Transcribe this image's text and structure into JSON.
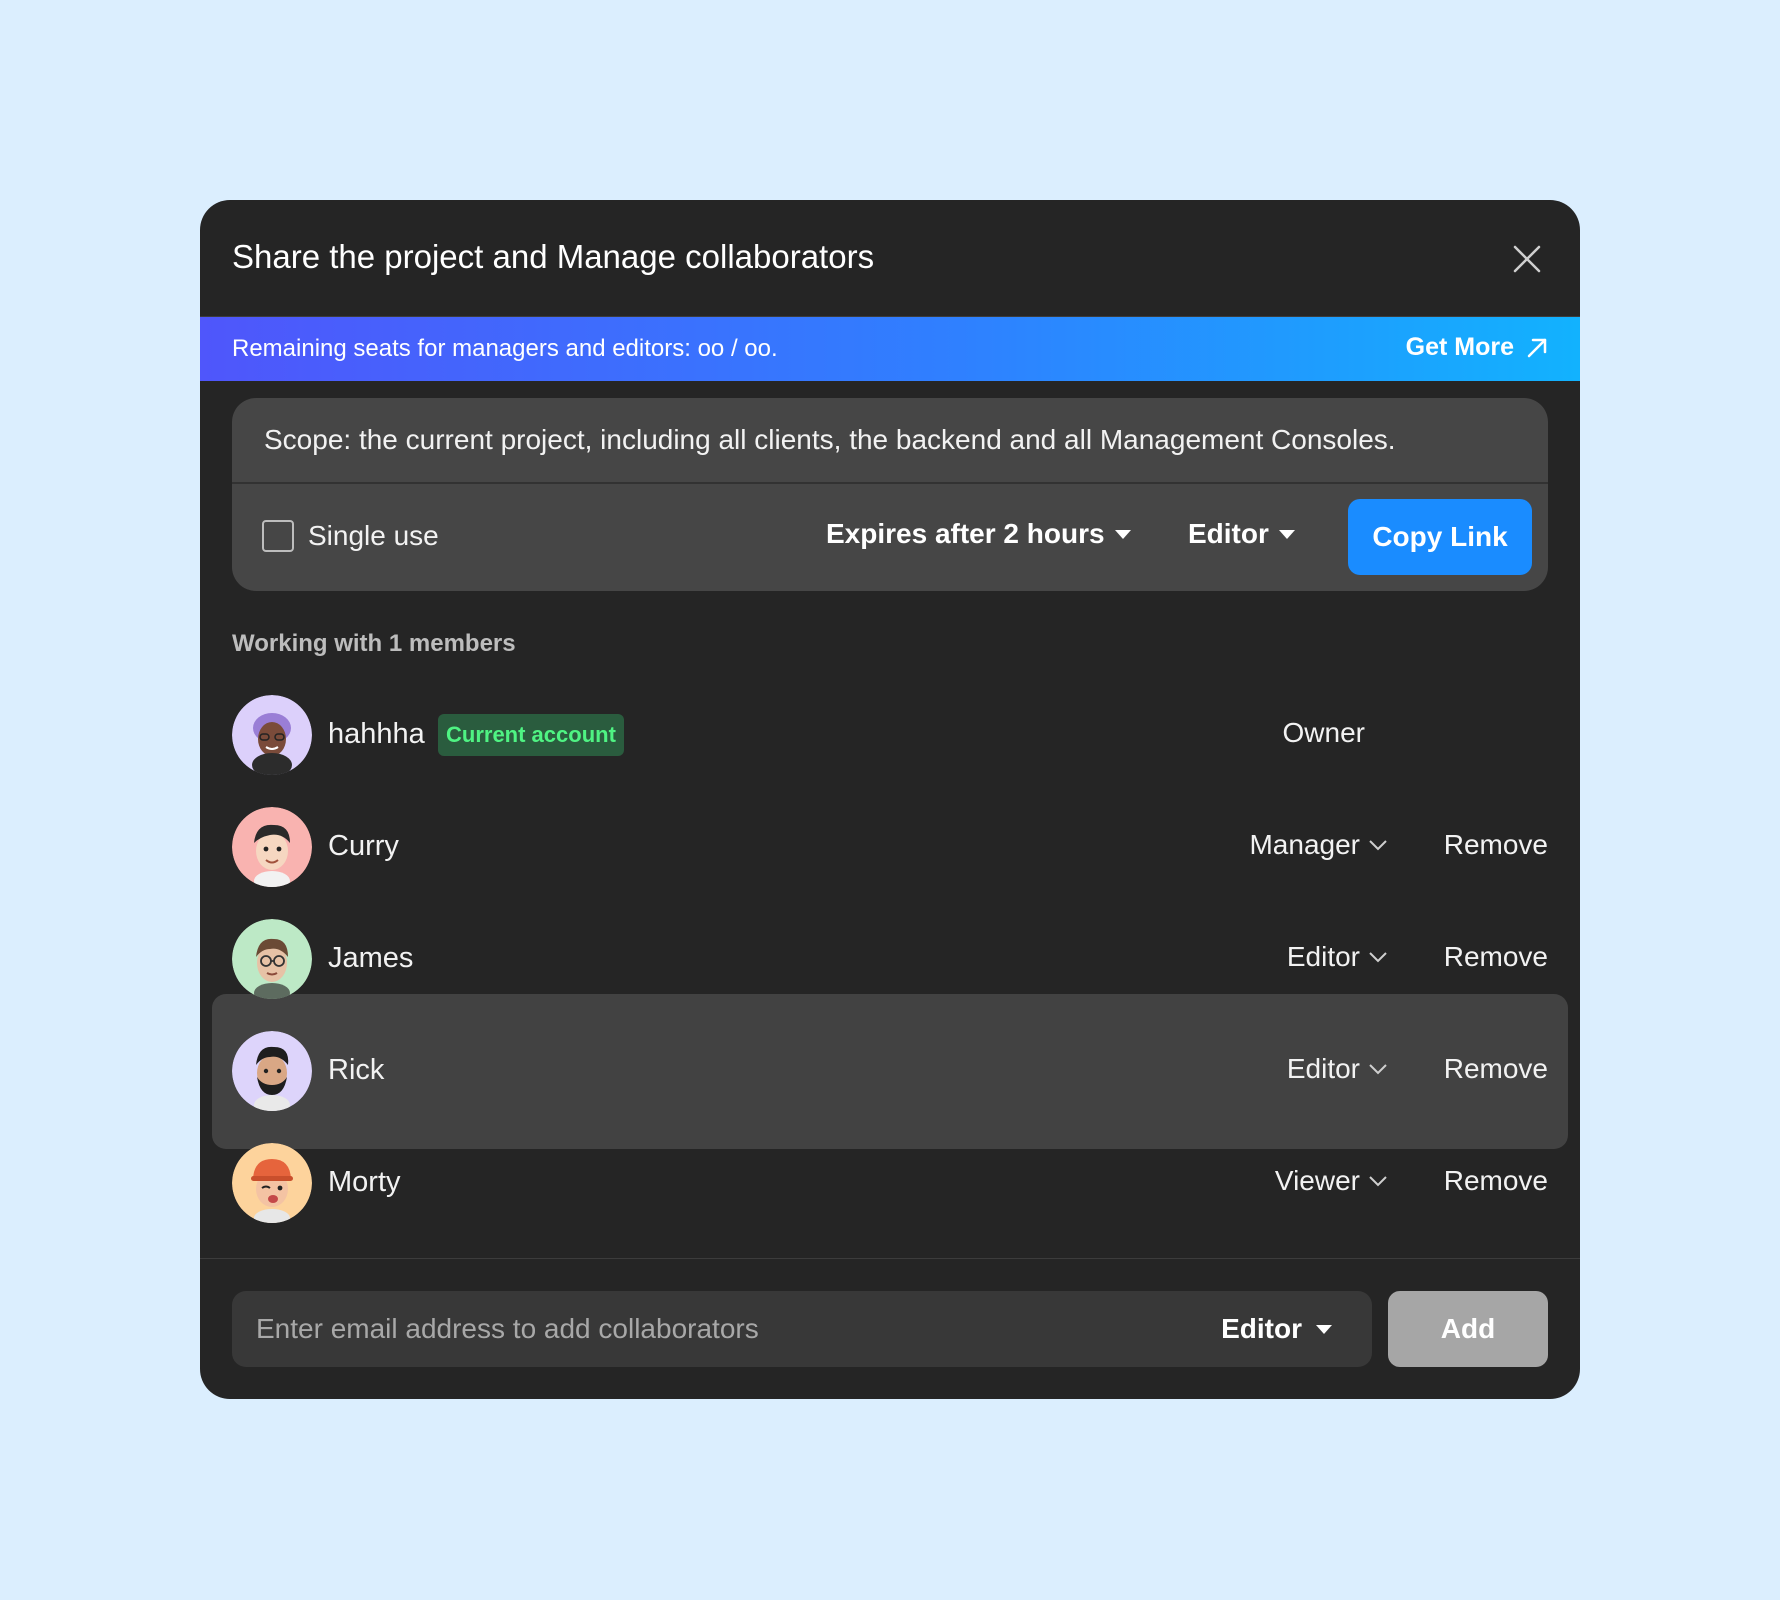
{
  "dialog": {
    "title": "Share the project and Manage collaborators",
    "close_icon": "close-icon"
  },
  "banner": {
    "text": "Remaining seats for managers and editors: oo / oo.",
    "get_more_label": "Get More",
    "get_more_icon": "arrow-up-right-icon"
  },
  "link_card": {
    "scope_text": "Scope: the current project, including all clients, the backend and all Management Consoles.",
    "single_use_label": "Single use",
    "single_use_checked": false,
    "expiry_label": "Expires after 2 hours",
    "role_label": "Editor",
    "copy_link_label": "Copy Link"
  },
  "members": {
    "heading": "Working with 1 members",
    "items": [
      {
        "name": "hahhha",
        "badge": "Current account",
        "role": "Owner",
        "avatar_bg": "#dcd0fb"
      },
      {
        "name": "Curry",
        "role": "Manager",
        "remove_label": "Remove",
        "avatar_bg": "#f9b3b0"
      },
      {
        "name": "James",
        "role": "Editor",
        "remove_label": "Remove",
        "avatar_bg": "#bde9c6"
      },
      {
        "name": "Rick",
        "role": "Editor",
        "remove_label": "Remove",
        "avatar_bg": "#ddd4fb",
        "highlighted": true
      },
      {
        "name": "Morty",
        "role": "Viewer",
        "remove_label": "Remove",
        "avatar_bg": "#fdd39c"
      }
    ]
  },
  "invite": {
    "email_placeholder": "Enter email address to add collaborators",
    "email_value": "",
    "role_label": "Editor",
    "add_label": "Add"
  },
  "colors": {
    "page_background": "#dbeefe",
    "modal_background": "#252525",
    "accent_blue": "#1a8cff",
    "badge_green": "#4ff383",
    "add_button_disabled": "#a6a6a6"
  }
}
